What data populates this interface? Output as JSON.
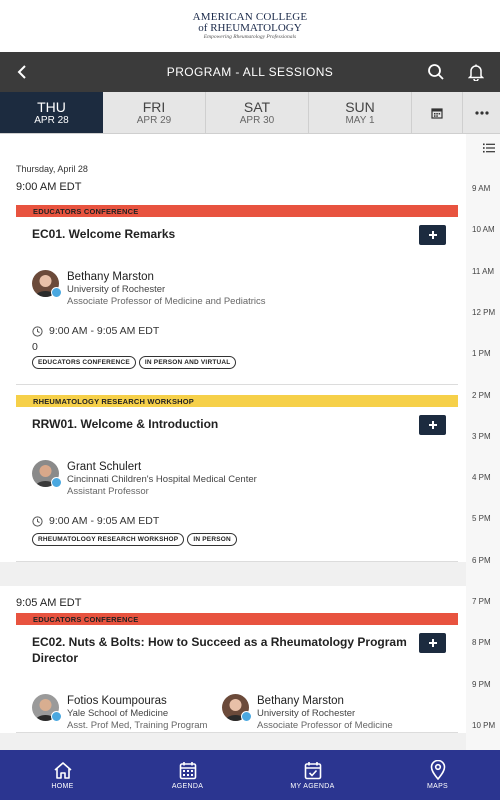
{
  "brand": {
    "line1": "AMERICAN COLLEGE",
    "line2": "of RHEUMATOLOGY",
    "tagline": "Empowering Rheumatology Professionals"
  },
  "header": {
    "title": "PROGRAM - ALL SESSIONS"
  },
  "days": [
    {
      "name": "THU",
      "date": "APR 28"
    },
    {
      "name": "FRI",
      "date": "APR 29"
    },
    {
      "name": "SAT",
      "date": "APR 30"
    },
    {
      "name": "SUN",
      "date": "MAY 1"
    }
  ],
  "date_heading": "Thursday, April 28",
  "groups": [
    {
      "time": "9:00 AM EDT",
      "sessions": [
        {
          "track": "EDUCATORS CONFERENCE",
          "title": "EC01. Welcome Remarks",
          "speakers": [
            {
              "name": "Bethany Marston",
              "org": "University of Rochester",
              "role": "Associate Professor of Medicine and Pediatrics"
            }
          ],
          "time": "9:00 AM - 9:05 AM EDT",
          "extra": "0",
          "tags": [
            "EDUCATORS CONFERENCE",
            "IN PERSON AND VIRTUAL"
          ]
        },
        {
          "track": "RHEUMATOLOGY RESEARCH WORKSHOP",
          "title": "RRW01. Welcome & Introduction",
          "speakers": [
            {
              "name": "Grant Schulert",
              "org": "Cincinnati Children's Hospital Medical Center",
              "role": "Assistant Professor"
            }
          ],
          "time": "9:00 AM - 9:05 AM EDT",
          "tags": [
            "RHEUMATOLOGY RESEARCH WORKSHOP",
            "IN PERSON"
          ]
        }
      ]
    },
    {
      "time": "9:05 AM EDT",
      "sessions": [
        {
          "track": "EDUCATORS CONFERENCE",
          "title": "EC02. Nuts & Bolts: How to Succeed as a Rheumatology Program Director",
          "speakers": [
            {
              "name": "Fotios Koumpouras",
              "org": "Yale School of Medicine",
              "role": "Asst. Prof Med, Training Program"
            },
            {
              "name": "Bethany Marston",
              "org": "University of Rochester",
              "role": "Associate Professor of Medicine"
            }
          ]
        }
      ]
    }
  ],
  "hours": [
    "9 AM",
    "10 AM",
    "11 AM",
    "12 PM",
    "1 PM",
    "2 PM",
    "3 PM",
    "4 PM",
    "5 PM",
    "6 PM",
    "7 PM",
    "8 PM",
    "9 PM",
    "10 PM"
  ],
  "nav": {
    "home": "HOME",
    "agenda": "AGENDA",
    "my_agenda": "MY AGENDA",
    "maps": "MAPS"
  },
  "colors": {
    "header": "#3b3b3b",
    "active_day": "#1c2b3f",
    "educators_track": "#e8533f",
    "research_track": "#f6d049",
    "bottom_nav": "#2b3590"
  }
}
